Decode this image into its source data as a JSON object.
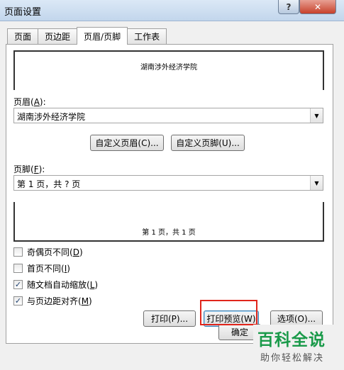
{
  "window": {
    "title": "页面设置",
    "help_label": "?",
    "close_label": "✕"
  },
  "tabs": [
    {
      "label": "页面"
    },
    {
      "label": "页边距"
    },
    {
      "label": "页眉/页脚"
    },
    {
      "label": "工作表"
    }
  ],
  "active_tab": 2,
  "header_preview_text": "湖南涉外经济学院",
  "header_label": {
    "before": "页眉(",
    "key": "A",
    "after": "):"
  },
  "header_value": "湖南涉外经济学院",
  "custom_header_button": "自定义页眉(C)...",
  "custom_footer_button": "自定义页脚(U)...",
  "footer_label": {
    "before": "页脚(",
    "key": "F",
    "after": "):"
  },
  "footer_value": "第 1 页，共 ? 页",
  "footer_preview_text": "第 1 页，共 1 页",
  "checkboxes": [
    {
      "before": "奇偶页不同(",
      "key": "D",
      "after": ")",
      "checked": false
    },
    {
      "before": "首页不同(",
      "key": "I",
      "after": ")",
      "checked": false
    },
    {
      "before": "随文档自动缩放(",
      "key": "L",
      "after": ")",
      "checked": true
    },
    {
      "before": "与页边距对齐(",
      "key": "M",
      "after": ")",
      "checked": true
    }
  ],
  "buttons": {
    "print": "打印(P)...",
    "print_preview": "打印预览(W)",
    "options": "选项(O)...",
    "ok": "确定"
  },
  "watermark": {
    "main": "百科全说",
    "sub": "助你轻松解决"
  },
  "colors": {
    "highlight": "#e0251b",
    "watermark": "#1a9a4a"
  },
  "check_mark": "✓",
  "combo_arrow": "▼"
}
